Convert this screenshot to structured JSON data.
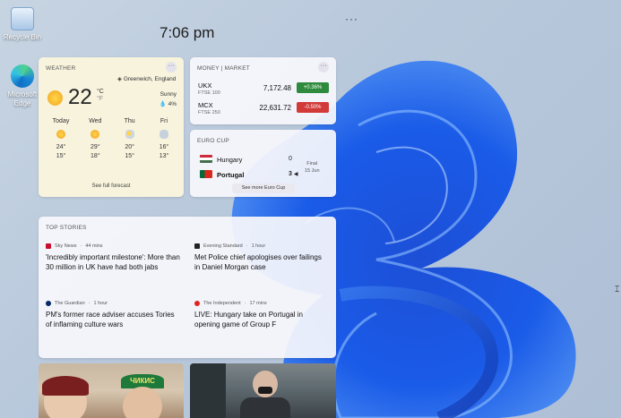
{
  "desktop": {
    "recycle_label": "Recycle Bin",
    "edge_label": "Microsoft Edge"
  },
  "panel": {
    "time": "7:06 pm",
    "top_more": "···"
  },
  "weather": {
    "title": "WEATHER",
    "location": "Greenwich, England",
    "temp": "22",
    "unit_c": "°C",
    "unit_f": "°F",
    "condition": "Sunny",
    "precip": "4%",
    "days": [
      {
        "name": "Today",
        "icon": "sun-icon",
        "high": "24°",
        "low": "15°"
      },
      {
        "name": "Wed",
        "icon": "sun-icon",
        "high": "29°",
        "low": "18°"
      },
      {
        "name": "Thu",
        "icon": "partly-cloudy-icon",
        "high": "20°",
        "low": "15°"
      },
      {
        "name": "Fri",
        "icon": "rain-icon",
        "high": "16°",
        "low": "13°"
      }
    ],
    "forecast_link": "See full forecast"
  },
  "market": {
    "title": "MONEY | MARKET",
    "stocks": [
      {
        "symbol": "UKX",
        "index": "FTSE 100",
        "price": "7,172.48",
        "change": "+0.36%",
        "color": "#2e8b3d"
      },
      {
        "symbol": "MCX",
        "index": "FTSE 250",
        "price": "22,631.72",
        "change": "-0.50%",
        "color": "#d23a3a"
      }
    ]
  },
  "euro": {
    "title": "EURO CUP",
    "team1": "Hungary",
    "score1": "0",
    "team2": "Portugal",
    "score2": "3",
    "status": "Final",
    "date": "15 Jun",
    "link": "See more Euro Cup"
  },
  "stories": {
    "title": "TOP STORIES",
    "items": [
      {
        "source": "Sky News",
        "age": "44 mins",
        "headline": "'Incredibly important milestone': More than 30 million in UK have had both jabs",
        "logo_color": "#c8102e"
      },
      {
        "source": "Evening Standard",
        "age": "1 hour",
        "headline": "Met Police chief apologises over failings in Daniel Morgan case",
        "logo_color": "#222222"
      },
      {
        "source": "The Guardian",
        "age": "1 hour",
        "headline": "PM's former race adviser accuses Tories of inflaming culture wars",
        "logo_color": "#052962"
      },
      {
        "source": "The Independent",
        "age": "17 mins",
        "headline": "LIVE: Hungary take on Portugal in opening game of Group F",
        "logo_color": "#e2231a"
      }
    ]
  },
  "photo_sign": "ЧИКИС"
}
